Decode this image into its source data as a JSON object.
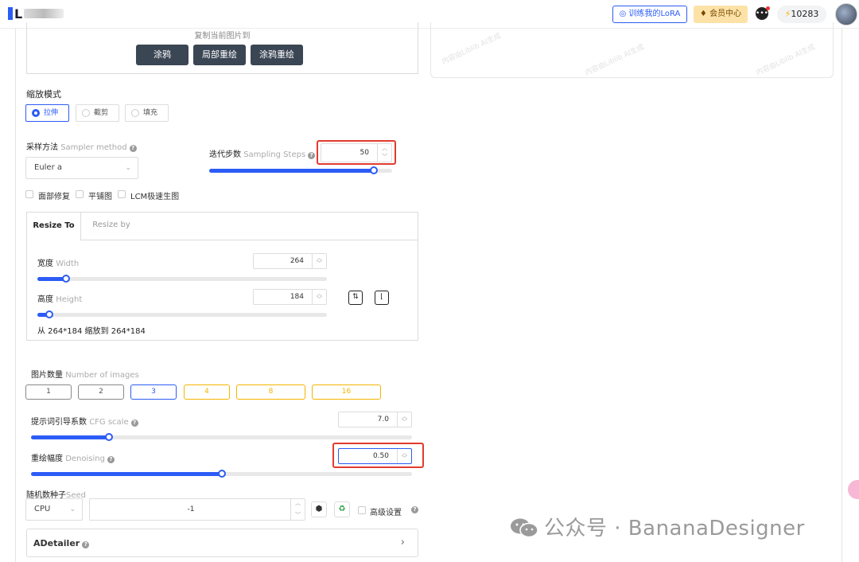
{
  "topbar": {
    "logo_text": "L",
    "train_lora": "训练我的LoRA",
    "vip_center": "会员中心",
    "credits": "10283",
    "msg_icon": "chat-bubble-icon",
    "bolt_icon": "bolt-icon"
  },
  "copy_section": {
    "title": "复制当前图片到",
    "buttons": [
      "涂鸦",
      "局部重绘",
      "涂鸦重绘"
    ]
  },
  "resize_mode": {
    "label": "缩放模式",
    "options": [
      "拉伸",
      "截剪",
      "填充"
    ],
    "selected": "拉伸"
  },
  "sampler": {
    "label": "采样方法",
    "hint": "Sampler method",
    "value": "Euler a"
  },
  "steps": {
    "label": "迭代步数",
    "hint": "Sampling Steps",
    "value": "50",
    "level": 0.9
  },
  "checkboxes": [
    "面部修复",
    "平铺图",
    "LCM极速生图"
  ],
  "size_tabs": {
    "tabs": [
      "Resize To",
      "Resize by"
    ],
    "active": "Resize To",
    "width_label": "宽度",
    "width_hint": "Width",
    "width_value": "264",
    "width_level": 0.1,
    "height_label": "高度",
    "height_hint": "Height",
    "height_value": "184",
    "height_level": 0.04,
    "summary": "从 264*184 缩放到 264*184"
  },
  "num_images": {
    "label": "图片数量",
    "hint": "Number of images",
    "options": [
      "1",
      "2",
      "3",
      "4",
      "8",
      "16"
    ],
    "selected": "3"
  },
  "cfg": {
    "label": "提示词引导系数",
    "hint": "CFG scale",
    "value": "7.0",
    "level": 0.205
  },
  "denoise": {
    "label": "重绘幅度",
    "hint": "Denoising",
    "value": "0.50",
    "level": 0.5
  },
  "seed": {
    "label": "随机数种子",
    "hint": "Seed",
    "device": "CPU",
    "value": "-1",
    "advanced": "高级设置"
  },
  "adetailer": {
    "label": "ADetailer"
  },
  "watermark": {
    "text": "公众号 · BananaDesigner"
  },
  "preview_watermark": "内容由Liblib AI生成",
  "colors": {
    "accent": "#2c5cf6",
    "highlight": "#e23b2e",
    "gold": "#f5b400"
  }
}
